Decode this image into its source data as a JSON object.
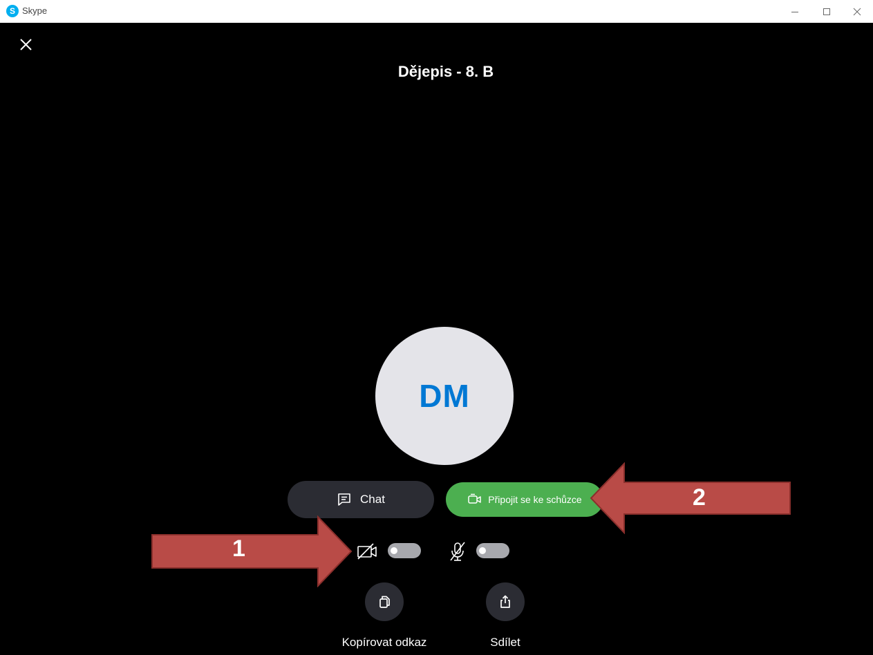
{
  "window": {
    "app_name": "Skype",
    "logo_letter": "S"
  },
  "meeting": {
    "title": "Dějepis - 8. B",
    "avatar_initials": "DM"
  },
  "actions": {
    "chat_label": "Chat",
    "join_label": "Připojit se ke schůzce"
  },
  "toggles": {
    "camera_on": false,
    "mic_on": false
  },
  "bottom_actions": {
    "copy_link_label": "Kopírovat odkaz",
    "share_label": "Sdílet"
  },
  "annotations": {
    "arrow1_number": "1",
    "arrow2_number": "2",
    "arrow_color": "#b94b47"
  },
  "colors": {
    "accent_green": "#4caf50",
    "avatar_bg": "#e4e4e9",
    "initials_blue": "#0078d4",
    "dark_button": "#2b2c33"
  }
}
